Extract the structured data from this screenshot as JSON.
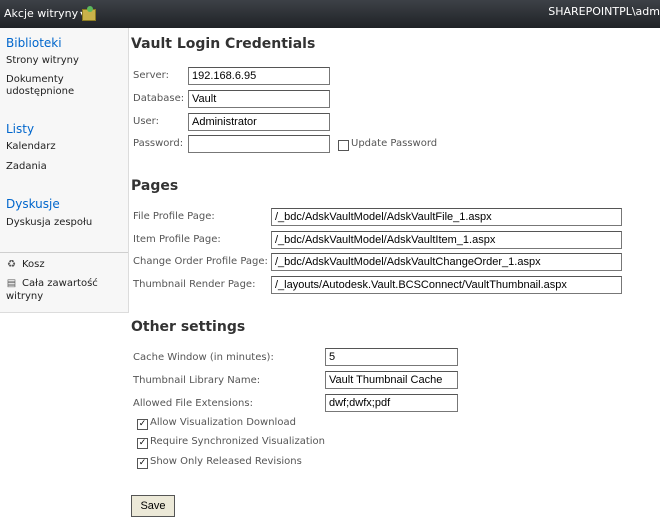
{
  "topbar": {
    "site_actions": "Akcje witryny",
    "user": "SHAREPOINTPL\\adm"
  },
  "sidebar": {
    "biblioteki": "Biblioteki",
    "strony": "Strony witryny",
    "dokumenty_1": "Dokumenty",
    "dokumenty_2": "udostępnione",
    "listy": "Listy",
    "kalendarz": "Kalendarz",
    "zadania": "Zadania",
    "dyskusje": "Dyskusje",
    "dyskusja": "Dyskusja zespołu",
    "kosz": "Kosz",
    "cala_1": "Cała zawartość",
    "cala_2": "witryny"
  },
  "login": {
    "title": "Vault Login Credentials",
    "server_label": "Server:",
    "server_value": "192.168.6.95",
    "database_label": "Database:",
    "database_value": "Vault",
    "user_label": "User:",
    "user_value": "Administrator",
    "password_label": "Password:",
    "password_value": "",
    "update_password": "Update Password"
  },
  "pages": {
    "title": "Pages",
    "file_label": "File Profile Page:",
    "file_value": "/_bdc/AdskVaultModel/AdskVaultFile_1.aspx",
    "item_label": "Item Profile Page:",
    "item_value": "/_bdc/AdskVaultModel/AdskVaultItem_1.aspx",
    "change_label": "Change Order Profile Page:",
    "change_value": "/_bdc/AdskVaultModel/AdskVaultChangeOrder_1.aspx",
    "thumb_label": "Thumbnail Render Page:",
    "thumb_value": "/_layouts/Autodesk.Vault.BCSConnect/VaultThumbnail.aspx"
  },
  "other": {
    "title": "Other settings",
    "cache_label": "Cache Window (in minutes):",
    "cache_value": "5",
    "thumblib_label": "Thumbnail Library Name:",
    "thumblib_value": "Vault Thumbnail Cache",
    "ext_label": "Allowed File Extensions:",
    "ext_value": "dwf;dwfx;pdf",
    "allow_viz": "Allow Visualization Download",
    "require_sync": "Require Synchronized Visualization",
    "show_released": "Show Only Released Revisions"
  },
  "save_label": "Save"
}
